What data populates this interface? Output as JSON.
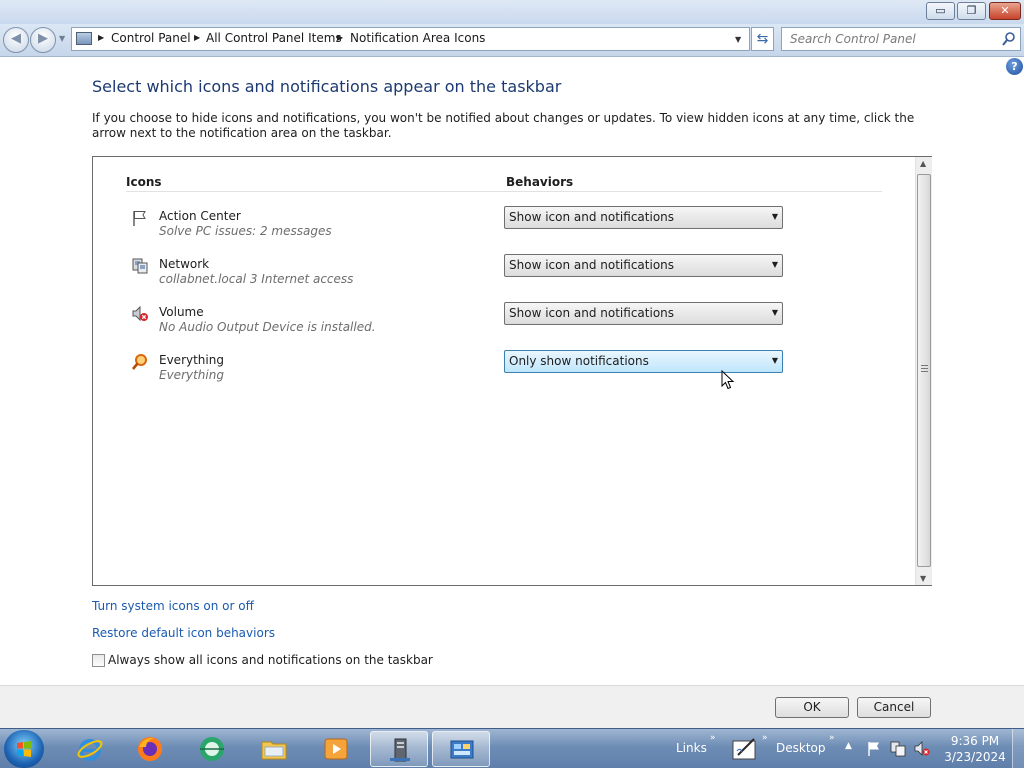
{
  "window": {
    "minimize_label": "▭",
    "maximize_label": "❐",
    "close_label": "✕"
  },
  "navbar": {
    "breadcrumbs": [
      "Control Panel",
      "All Control Panel Items",
      "Notification Area Icons"
    ],
    "search_placeholder": "Search Control Panel"
  },
  "page": {
    "title": "Select which icons and notifications appear on the taskbar",
    "description": "If you choose to hide icons and notifications, you won't be notified about changes or updates. To view hidden icons at any time, click the arrow next to the notification area on the taskbar."
  },
  "table": {
    "col_icons": "Icons",
    "col_behaviors": "Behaviors",
    "rows": [
      {
        "name": "Action Center",
        "sub": "Solve PC issues: 2 messages",
        "icon": "flag-icon",
        "behavior": "Show icon and notifications"
      },
      {
        "name": "Network",
        "sub": "collabnet.local  3 Internet access",
        "icon": "network-icon",
        "behavior": "Show icon and notifications"
      },
      {
        "name": "Volume",
        "sub": "No Audio Output Device is installed.",
        "icon": "speaker-muted-icon",
        "behavior": "Show icon and notifications"
      },
      {
        "name": "Everything",
        "sub": "Everything",
        "icon": "magnifier-icon",
        "behavior": "Only show notifications"
      }
    ]
  },
  "links": {
    "system_icons": "Turn system icons on or off",
    "restore_defaults": "Restore default icon behaviors"
  },
  "checkbox": {
    "label": "Always show all icons and notifications on the taskbar",
    "checked": false
  },
  "footer": {
    "ok_label": "OK",
    "cancel_label": "Cancel"
  },
  "taskbar": {
    "links_label": "Links",
    "desktop_label": "Desktop",
    "time": "9:36 PM",
    "date": "3/23/2024",
    "apps": [
      "internet-explorer",
      "firefox",
      "globe-app",
      "file-explorer",
      "media-player",
      "server-manager",
      "control-panel"
    ]
  }
}
